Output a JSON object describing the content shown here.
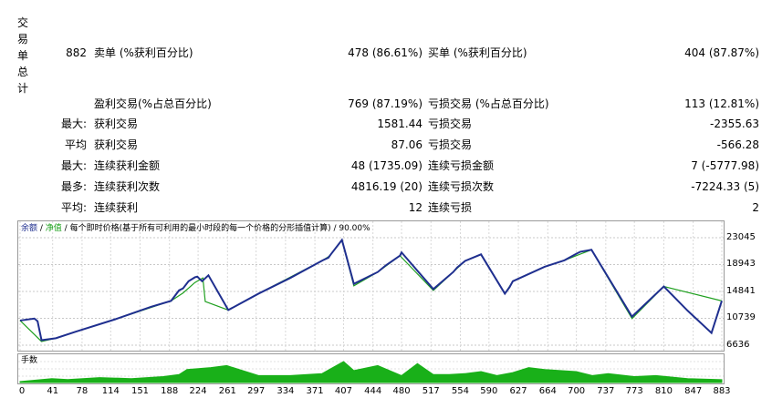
{
  "sidebar_title": "交易单总计",
  "rows": [
    {
      "c1_label": "",
      "c1_value": "882",
      "c2_label": "卖单 (%获利百分比)",
      "c2_value": "478 (86.61%)",
      "c3_label": "买单 (%获利百分比)",
      "c3_value": "404 (87.87%)"
    },
    {
      "c1_label": "",
      "c1_value": "",
      "c2_label": "盈利交易(%占总百分比)",
      "c2_value": "769 (87.19%)",
      "c3_label": "亏损交易 (%占总百分比)",
      "c3_value": "113 (12.81%)"
    },
    {
      "c1_label": "最大:",
      "c1_value": "",
      "c2_label": "获利交易",
      "c2_value": "1581.44",
      "c3_label": "亏损交易",
      "c3_value": "-2355.63"
    },
    {
      "c1_label": "平均",
      "c1_value": "",
      "c2_label": "获利交易",
      "c2_value": "87.06",
      "c3_label": "亏损交易",
      "c3_value": "-566.28"
    },
    {
      "c1_label": "最大:",
      "c1_value": "",
      "c2_label": "连续获利金额",
      "c2_value": "48 (1735.09)",
      "c3_label": "连续亏损金额",
      "c3_value": "7 (-5777.98)"
    },
    {
      "c1_label": "最多:",
      "c1_value": "",
      "c2_label": "连续获利次数",
      "c2_value": "4816.19 (20)",
      "c3_label": "连续亏损次数",
      "c3_value": "-7224.33 (5)"
    },
    {
      "c1_label": "平均:",
      "c1_value": "",
      "c2_label": "连续获利",
      "c2_value": "12",
      "c3_label": "连续亏损",
      "c3_value": "2"
    }
  ],
  "chart_data": {
    "type": "line",
    "legend": {
      "balance": "余额",
      "sep1": " / ",
      "equity": "净值",
      "sep2": " / ",
      "text": "每个即时价格(基于所有可利用的最小时段的每一个价格的分形插值计算)",
      "sep3": " / ",
      "quality": "90.00%"
    },
    "ylim": [
      6636,
      23045
    ],
    "yticks": [
      23045,
      18943,
      14841,
      10739,
      6636
    ],
    "xlim": [
      0,
      883
    ],
    "xticks": [
      0,
      41,
      78,
      114,
      151,
      188,
      224,
      261,
      297,
      334,
      371,
      407,
      444,
      480,
      517,
      554,
      590,
      627,
      664,
      700,
      737,
      773,
      810,
      847,
      883
    ],
    "series": [
      {
        "name": "余额",
        "color": "#1f2f8f",
        "x": [
          0,
          18,
          22,
          27,
          45,
          70,
          120,
          165,
          190,
          200,
          205,
          212,
          220,
          223,
          229,
          237,
          262,
          300,
          340,
          381,
          388,
          391,
          405,
          420,
          450,
          460,
          472,
          478,
          480,
          520,
          545,
          550,
          560,
          580,
          610,
          616,
          620,
          660,
          685,
          700,
          705,
          719,
          770,
          810,
          840,
          870,
          883
        ],
        "y": [
          10400,
          10700,
          10300,
          7400,
          7700,
          8700,
          10600,
          12500,
          13400,
          15000,
          15300,
          16400,
          17000,
          17100,
          16400,
          17300,
          12000,
          14500,
          16900,
          19600,
          20000,
          20500,
          22700,
          16000,
          17800,
          18800,
          19800,
          20300,
          20800,
          15200,
          17800,
          18500,
          19500,
          20500,
          14500,
          15500,
          16400,
          18600,
          19600,
          20600,
          20900,
          21200,
          11000,
          15600,
          11900,
          8500,
          13400
        ]
      },
      {
        "name": "净值",
        "color": "#20a020",
        "x": [
          0,
          27,
          45,
          70,
          120,
          190,
          205,
          220,
          230,
          233,
          262,
          300,
          381,
          390,
          405,
          420,
          450,
          478,
          520,
          545,
          560,
          580,
          610,
          620,
          660,
          685,
          719,
          770,
          810,
          883
        ],
        "y": [
          10400,
          7200,
          7700,
          8700,
          10600,
          13400,
          14600,
          16200,
          16900,
          13300,
          12000,
          14500,
          19600,
          20300,
          22700,
          15700,
          17800,
          20300,
          15000,
          17800,
          19500,
          20500,
          14500,
          16400,
          18600,
          19600,
          21200,
          10700,
          15600,
          13400
        ]
      }
    ],
    "volume": {
      "name": "手数",
      "color": "#19b019",
      "x": [
        0,
        40,
        60,
        100,
        140,
        180,
        200,
        210,
        240,
        260,
        300,
        340,
        380,
        407,
        420,
        450,
        480,
        500,
        520,
        540,
        560,
        580,
        600,
        620,
        640,
        660,
        700,
        720,
        740,
        773,
        800,
        840,
        883
      ],
      "v": [
        0,
        0.15,
        0.1,
        0.2,
        0.15,
        0.25,
        0.35,
        0.6,
        0.7,
        0.8,
        0.3,
        0.3,
        0.4,
        1.0,
        0.55,
        0.8,
        0.3,
        0.9,
        0.35,
        0.35,
        0.4,
        0.5,
        0.3,
        0.45,
        0.7,
        0.6,
        0.5,
        0.3,
        0.4,
        0.25,
        0.3,
        0.15,
        0.1
      ]
    }
  }
}
